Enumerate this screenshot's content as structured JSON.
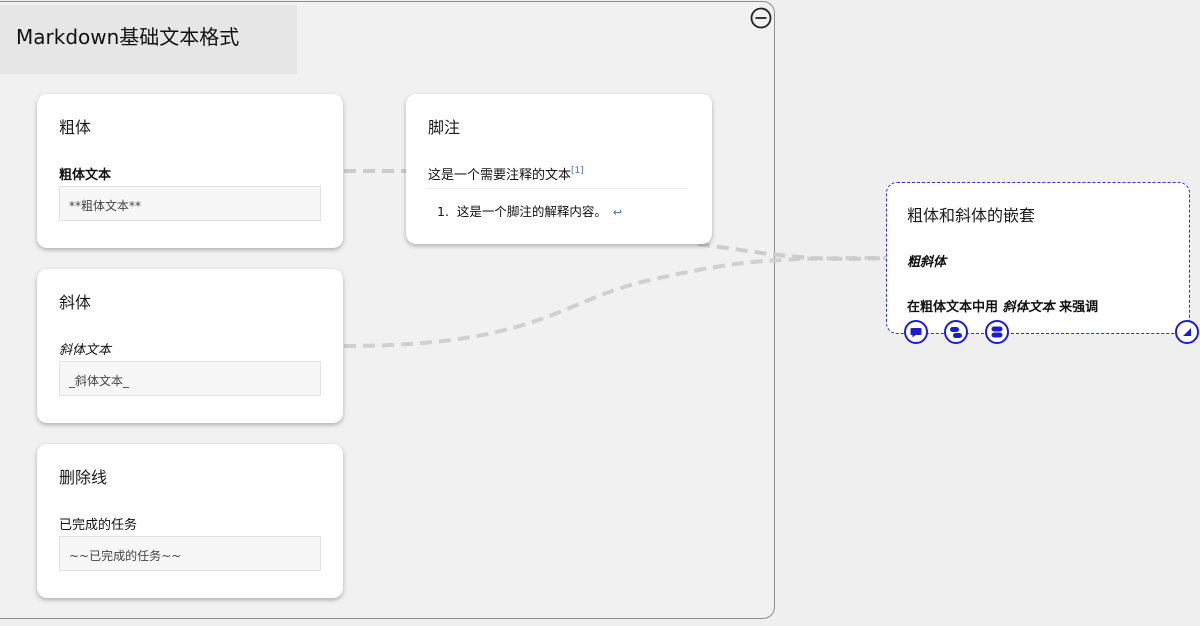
{
  "group": {
    "title": "Markdown基础文本格式",
    "collapse_icon": "minus-circle-icon"
  },
  "cards": {
    "bold": {
      "title": "粗体",
      "label": "粗体文本",
      "input": "**粗体文本**"
    },
    "italic": {
      "title": "斜体",
      "label": "斜体文本",
      "input": "_斜体文本_"
    },
    "strike": {
      "title": "删除线",
      "label": "已完成的任务",
      "input": "~~已完成的任务~~"
    },
    "footnote": {
      "title": "脚注",
      "text": "这是一个需要注释的文本",
      "ref": "[1]",
      "item_number": "1.",
      "item_text": "这是一个脚注的解释内容。",
      "back_icon": "↩"
    }
  },
  "selected": {
    "title": "粗体和斜体的嵌套",
    "line1": "粗斜体",
    "line2_prefix": "在粗体文本中用",
    "line2_em": "斜体文本",
    "line2_suffix": "来强调",
    "handles": [
      "comment-icon",
      "node-group-icon",
      "node-stack-icon",
      "resize-icon"
    ]
  },
  "colors": {
    "selection": "#1d1dcf",
    "edge": "#cccccc",
    "footnote_link": "#3b6fc5"
  }
}
